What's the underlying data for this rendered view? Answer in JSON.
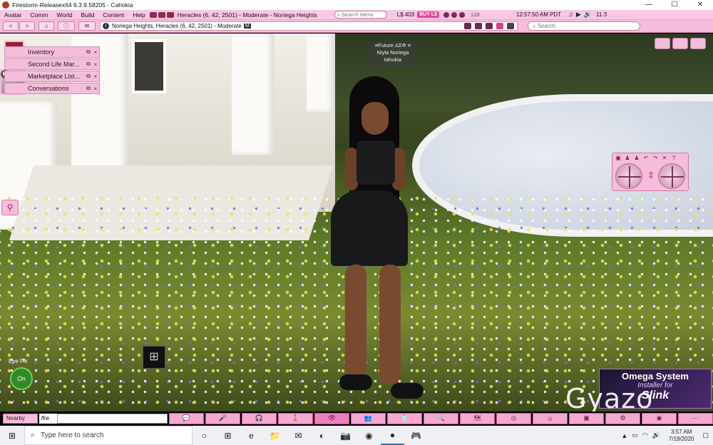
{
  "window": {
    "title": "Firestorm-Releasex64 6.3.9.58205 - Cahokia",
    "min": "—",
    "max": "☐",
    "close": "✕"
  },
  "menu": {
    "items": [
      "Avatar",
      "Comm",
      "World",
      "Build",
      "Content",
      "Help"
    ],
    "location": "Heracles (6, 42, 2501) - Moderate - Noriega Heights",
    "search_placeholder": "Search Menu",
    "balance": "L$ 403",
    "buy": "BUY L$",
    "fps": "128",
    "time": "12:57:50 AM PDT",
    "bandwidth": "11.3"
  },
  "nav": {
    "back": "<",
    "forward": ">",
    "home_icon": "home-icon",
    "info_icon": "info-icon",
    "camera_icon": "camera-icon",
    "location_text": "Noriega Heights, Heracles (6, 42, 2501) - Moderate",
    "rating": "M",
    "search_placeholder": "Search"
  },
  "floaters": [
    {
      "label": "Inventory"
    },
    {
      "label": "Second Life Mar..."
    },
    {
      "label": "Marketplace List..."
    },
    {
      "label": "Conversations"
    }
  ],
  "floater_buttons": {
    "detach": "⧉",
    "close": "×"
  },
  "nametag": {
    "line1": "≡Future ΔΣΦ ≡",
    "line2": "Niyla Noriega",
    "line3": "tahukia"
  },
  "movepad": {
    "icons": [
      "▣",
      "♟",
      "♟",
      "↶",
      "↷",
      "✕",
      "?"
    ]
  },
  "eyefix": {
    "label": "Eye Fix",
    "state": "On"
  },
  "ad": {
    "line1": "Omega System",
    "line2": "Installer for",
    "line3": "Slink",
    "watermark": "Gyazo"
  },
  "chat": {
    "nearby_label": "Nearby Chat",
    "prefix": "/fre"
  },
  "toolbar": {
    "buttons": [
      {
        "name": "toolbar-chat",
        "glyph": "💬"
      },
      {
        "name": "toolbar-speak",
        "glyph": "🎤"
      },
      {
        "name": "toolbar-sound",
        "glyph": "🎧"
      },
      {
        "name": "toolbar-walk",
        "glyph": "🚶"
      },
      {
        "name": "toolbar-view",
        "glyph": "👁"
      },
      {
        "name": "toolbar-people",
        "glyph": "👥"
      },
      {
        "name": "toolbar-appearance",
        "glyph": "👕"
      },
      {
        "name": "toolbar-search",
        "glyph": "🔍"
      },
      {
        "name": "toolbar-map",
        "glyph": "🗺"
      },
      {
        "name": "toolbar-radar",
        "glyph": "◎"
      },
      {
        "name": "toolbar-gestures",
        "glyph": "☺"
      },
      {
        "name": "toolbar-snapshot",
        "glyph": "▣"
      },
      {
        "name": "toolbar-build",
        "glyph": "⚙"
      },
      {
        "name": "toolbar-minimap",
        "glyph": "◉"
      },
      {
        "name": "toolbar-more",
        "glyph": "⋯"
      }
    ]
  },
  "taskbar": {
    "search_placeholder": "Type here to search",
    "time": "3:57 AM",
    "date": "7/19/2020",
    "apps": [
      "○",
      "⊞",
      "e",
      "📁",
      "✉",
      "◐",
      "📷",
      "◉",
      "●",
      "🎮"
    ]
  }
}
